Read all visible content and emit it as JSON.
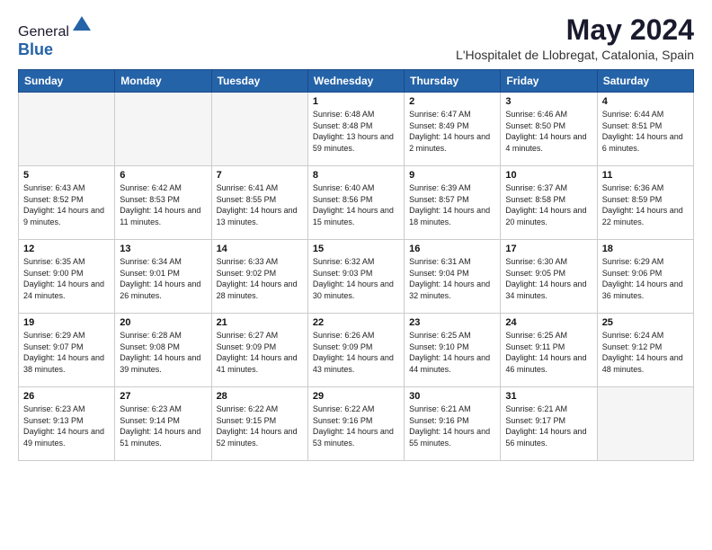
{
  "header": {
    "logo_general": "General",
    "logo_blue": "Blue",
    "month": "May 2024",
    "location": "L'Hospitalet de Llobregat, Catalonia, Spain"
  },
  "weekdays": [
    "Sunday",
    "Monday",
    "Tuesday",
    "Wednesday",
    "Thursday",
    "Friday",
    "Saturday"
  ],
  "weeks": [
    [
      {
        "day": "",
        "info": ""
      },
      {
        "day": "",
        "info": ""
      },
      {
        "day": "",
        "info": ""
      },
      {
        "day": "1",
        "info": "Sunrise: 6:48 AM\nSunset: 8:48 PM\nDaylight: 13 hours and 59 minutes."
      },
      {
        "day": "2",
        "info": "Sunrise: 6:47 AM\nSunset: 8:49 PM\nDaylight: 14 hours and 2 minutes."
      },
      {
        "day": "3",
        "info": "Sunrise: 6:46 AM\nSunset: 8:50 PM\nDaylight: 14 hours and 4 minutes."
      },
      {
        "day": "4",
        "info": "Sunrise: 6:44 AM\nSunset: 8:51 PM\nDaylight: 14 hours and 6 minutes."
      }
    ],
    [
      {
        "day": "5",
        "info": "Sunrise: 6:43 AM\nSunset: 8:52 PM\nDaylight: 14 hours and 9 minutes."
      },
      {
        "day": "6",
        "info": "Sunrise: 6:42 AM\nSunset: 8:53 PM\nDaylight: 14 hours and 11 minutes."
      },
      {
        "day": "7",
        "info": "Sunrise: 6:41 AM\nSunset: 8:55 PM\nDaylight: 14 hours and 13 minutes."
      },
      {
        "day": "8",
        "info": "Sunrise: 6:40 AM\nSunset: 8:56 PM\nDaylight: 14 hours and 15 minutes."
      },
      {
        "day": "9",
        "info": "Sunrise: 6:39 AM\nSunset: 8:57 PM\nDaylight: 14 hours and 18 minutes."
      },
      {
        "day": "10",
        "info": "Sunrise: 6:37 AM\nSunset: 8:58 PM\nDaylight: 14 hours and 20 minutes."
      },
      {
        "day": "11",
        "info": "Sunrise: 6:36 AM\nSunset: 8:59 PM\nDaylight: 14 hours and 22 minutes."
      }
    ],
    [
      {
        "day": "12",
        "info": "Sunrise: 6:35 AM\nSunset: 9:00 PM\nDaylight: 14 hours and 24 minutes."
      },
      {
        "day": "13",
        "info": "Sunrise: 6:34 AM\nSunset: 9:01 PM\nDaylight: 14 hours and 26 minutes."
      },
      {
        "day": "14",
        "info": "Sunrise: 6:33 AM\nSunset: 9:02 PM\nDaylight: 14 hours and 28 minutes."
      },
      {
        "day": "15",
        "info": "Sunrise: 6:32 AM\nSunset: 9:03 PM\nDaylight: 14 hours and 30 minutes."
      },
      {
        "day": "16",
        "info": "Sunrise: 6:31 AM\nSunset: 9:04 PM\nDaylight: 14 hours and 32 minutes."
      },
      {
        "day": "17",
        "info": "Sunrise: 6:30 AM\nSunset: 9:05 PM\nDaylight: 14 hours and 34 minutes."
      },
      {
        "day": "18",
        "info": "Sunrise: 6:29 AM\nSunset: 9:06 PM\nDaylight: 14 hours and 36 minutes."
      }
    ],
    [
      {
        "day": "19",
        "info": "Sunrise: 6:29 AM\nSunset: 9:07 PM\nDaylight: 14 hours and 38 minutes."
      },
      {
        "day": "20",
        "info": "Sunrise: 6:28 AM\nSunset: 9:08 PM\nDaylight: 14 hours and 39 minutes."
      },
      {
        "day": "21",
        "info": "Sunrise: 6:27 AM\nSunset: 9:09 PM\nDaylight: 14 hours and 41 minutes."
      },
      {
        "day": "22",
        "info": "Sunrise: 6:26 AM\nSunset: 9:09 PM\nDaylight: 14 hours and 43 minutes."
      },
      {
        "day": "23",
        "info": "Sunrise: 6:25 AM\nSunset: 9:10 PM\nDaylight: 14 hours and 44 minutes."
      },
      {
        "day": "24",
        "info": "Sunrise: 6:25 AM\nSunset: 9:11 PM\nDaylight: 14 hours and 46 minutes."
      },
      {
        "day": "25",
        "info": "Sunrise: 6:24 AM\nSunset: 9:12 PM\nDaylight: 14 hours and 48 minutes."
      }
    ],
    [
      {
        "day": "26",
        "info": "Sunrise: 6:23 AM\nSunset: 9:13 PM\nDaylight: 14 hours and 49 minutes."
      },
      {
        "day": "27",
        "info": "Sunrise: 6:23 AM\nSunset: 9:14 PM\nDaylight: 14 hours and 51 minutes."
      },
      {
        "day": "28",
        "info": "Sunrise: 6:22 AM\nSunset: 9:15 PM\nDaylight: 14 hours and 52 minutes."
      },
      {
        "day": "29",
        "info": "Sunrise: 6:22 AM\nSunset: 9:16 PM\nDaylight: 14 hours and 53 minutes."
      },
      {
        "day": "30",
        "info": "Sunrise: 6:21 AM\nSunset: 9:16 PM\nDaylight: 14 hours and 55 minutes."
      },
      {
        "day": "31",
        "info": "Sunrise: 6:21 AM\nSunset: 9:17 PM\nDaylight: 14 hours and 56 minutes."
      },
      {
        "day": "",
        "info": ""
      }
    ]
  ]
}
